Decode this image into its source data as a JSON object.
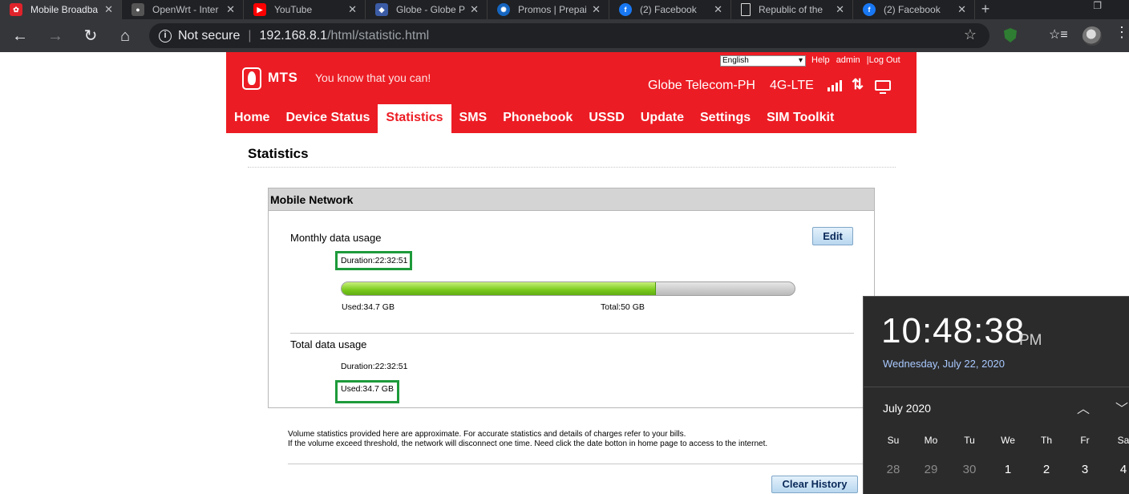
{
  "browser": {
    "tabs": [
      {
        "title": "Mobile Broadba",
        "icon": "huawei-icon",
        "color": "#e0222a",
        "active": true
      },
      {
        "title": "OpenWrt - Inter",
        "icon": "openwrt-icon",
        "color": "#555555",
        "active": false
      },
      {
        "title": "YouTube",
        "icon": "youtube-icon",
        "color": "#ff0000",
        "active": false
      },
      {
        "title": "Globe - Globe P",
        "icon": "globe-icon",
        "color": "#3b5ba5",
        "active": false
      },
      {
        "title": "Promos | Prepai",
        "icon": "promos-icon",
        "color": "#1565c0",
        "active": false
      },
      {
        "title": "(2) Facebook",
        "icon": "facebook-icon",
        "color": "#1877f2",
        "active": false
      },
      {
        "title": "Republic of the",
        "icon": "document-icon",
        "color": "#dddddd",
        "active": false
      },
      {
        "title": "(2) Facebook",
        "icon": "facebook-icon",
        "color": "#1877f2",
        "active": false
      }
    ],
    "address": {
      "security": "Not secure",
      "host": "192.168.8.1",
      "path": "/html/statistic.html"
    }
  },
  "header": {
    "logo": "MTS",
    "slogan": "You know that you can!",
    "language": "English",
    "links": {
      "help": "Help",
      "admin": "admin",
      "sep": "|",
      "logout": "Log Out"
    },
    "operator": "Globe Telecom-PH",
    "network_type": "4G-LTE",
    "nav": [
      "Home",
      "Device Status",
      "Statistics",
      "SMS",
      "Phonebook",
      "USSD",
      "Update",
      "Settings",
      "SIM Toolkit"
    ],
    "active_nav": "Statistics",
    "brand_color": "#ec1c24"
  },
  "page": {
    "title": "Statistics",
    "panel_title": "Mobile Network",
    "monthly": {
      "label": "Monthly data usage",
      "duration": "Duration:22:32:51",
      "used": "Used:34.7 GB",
      "total": "Total:50 GB",
      "used_fraction": 0.694,
      "edit_label": "Edit"
    },
    "total": {
      "label": "Total data usage",
      "duration": "Duration:22:32:51",
      "used": "Used:34.7 GB"
    },
    "note_line1": "Volume statistics provided here are approximate. For accurate statistics and details of charges refer to your bills.",
    "note_line2": "If the volume exceed threshold, the network will disconnect one time. Need click the date botton in home page to access to the internet.",
    "clear_label": "Clear History"
  },
  "clock": {
    "time": "10:48:38",
    "ampm": "PM",
    "date": "Wednesday, July 22, 2020",
    "month": "July 2020",
    "weekdays": [
      "Su",
      "Mo",
      "Tu",
      "We",
      "Th",
      "Fr",
      "Sa"
    ],
    "first_row": [
      "28",
      "29",
      "30",
      "1",
      "2",
      "3",
      "4"
    ]
  }
}
